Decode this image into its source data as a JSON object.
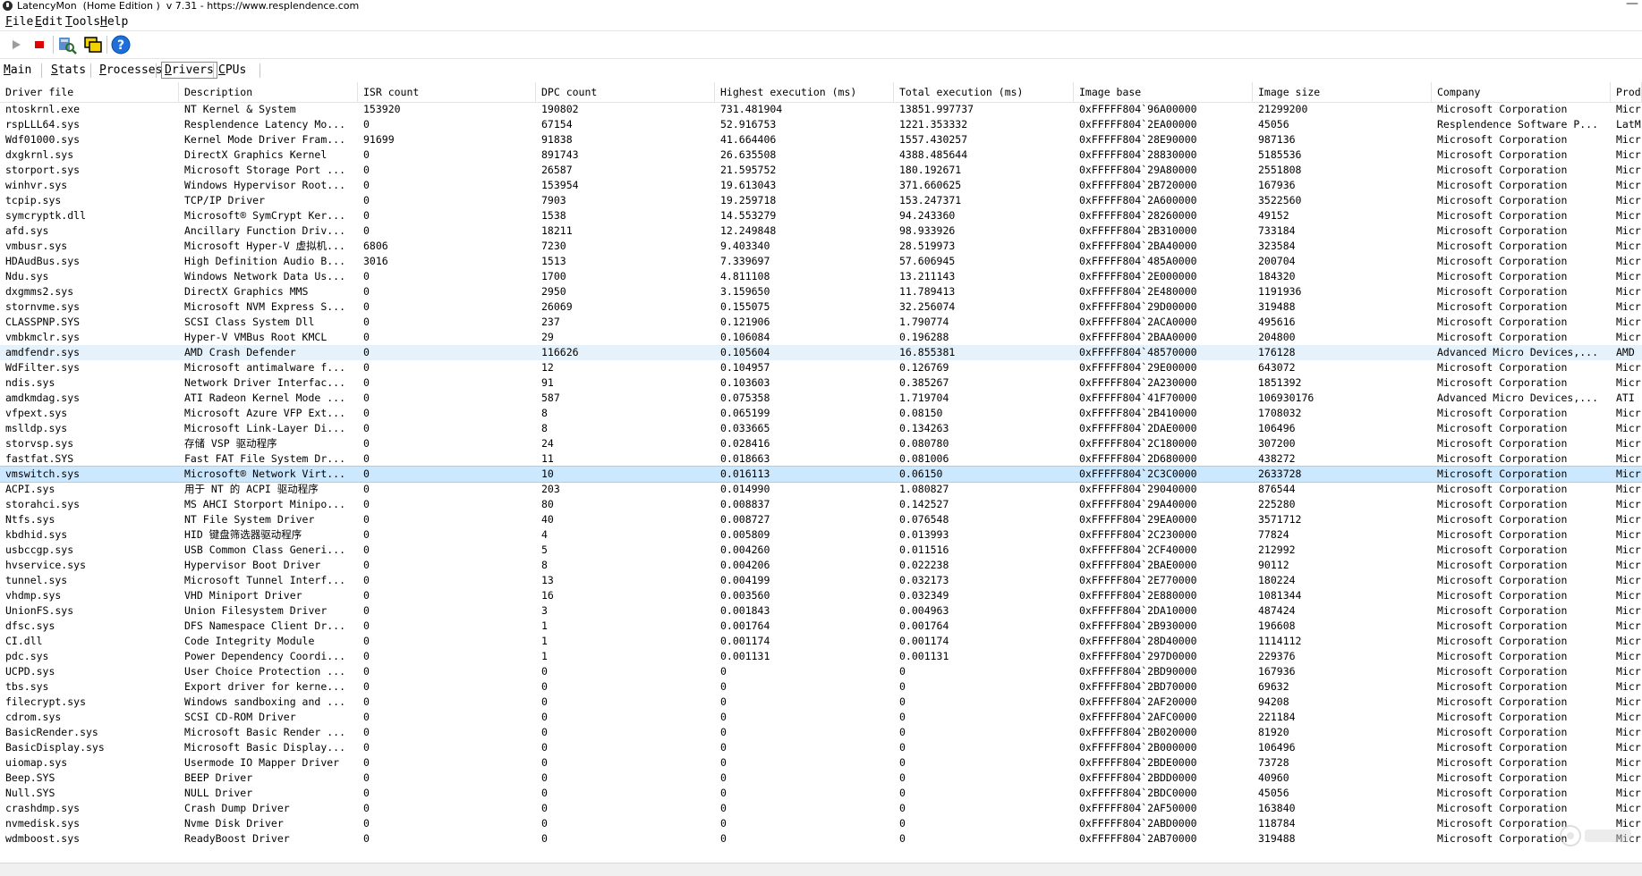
{
  "window": {
    "title": "LatencyMon  (Home Edition )  v 7.31 - https://www.resplendence.com",
    "minimize": "—"
  },
  "menu": [
    {
      "label": "File",
      "u": "F",
      "rest": "ile"
    },
    {
      "label": "Edit",
      "u": "E",
      "rest": "dit"
    },
    {
      "label": "Tools",
      "u": "T",
      "rest": "ools"
    },
    {
      "label": "Help",
      "u": "H",
      "rest": "elp"
    }
  ],
  "toolbar": {
    "icons": [
      "play-icon",
      "stop-icon",
      "search-drivers-icon",
      "windows-icon",
      "help-icon"
    ]
  },
  "tabs": [
    {
      "label": "Main",
      "u": "M",
      "rest": "ain",
      "active": false
    },
    {
      "label": "Stats",
      "u": "S",
      "rest": "tats",
      "active": false
    },
    {
      "label": "Processes",
      "u": "P",
      "rest": "rocesses",
      "active": false
    },
    {
      "label": "Drivers",
      "u": "D",
      "rest": "rivers",
      "active": true
    },
    {
      "label": "CPUs",
      "u": "C",
      "rest": "PUs",
      "active": false
    }
  ],
  "table": {
    "columns": [
      "Driver file",
      "Description",
      "ISR count",
      "DPC count",
      "Highest execution (ms)",
      "Total execution (ms)",
      "Image base",
      "Image size",
      "Company",
      "Prod"
    ],
    "rows": [
      [
        "ntoskrnl.exe",
        "NT Kernel & System",
        "153920",
        "190802",
        "731.481904",
        "13851.997737",
        "0xFFFFF804`96A00000",
        "21299200",
        "Microsoft Corporation",
        "Micr"
      ],
      [
        "rspLLL64.sys",
        "Resplendence Latency Mo...",
        "0",
        "67154",
        "52.916753",
        "1221.353332",
        "0xFFFFF804`2EA00000",
        "45056",
        "Resplendence Software P...",
        "LatM"
      ],
      [
        "Wdf01000.sys",
        "Kernel Mode Driver Fram...",
        "91699",
        "91838",
        "41.664406",
        "1557.430257",
        "0xFFFFF804`28E90000",
        "987136",
        "Microsoft Corporation",
        "Micr"
      ],
      [
        "dxgkrnl.sys",
        "DirectX Graphics Kernel",
        "0",
        "891743",
        "26.635508",
        "4388.485644",
        "0xFFFFF804`28830000",
        "5185536",
        "Microsoft Corporation",
        "Micr"
      ],
      [
        "storport.sys",
        "Microsoft Storage Port ...",
        "0",
        "26587",
        "21.595752",
        "180.192671",
        "0xFFFFF804`29A80000",
        "2551808",
        "Microsoft Corporation",
        "Micr"
      ],
      [
        "winhvr.sys",
        "Windows Hypervisor Root...",
        "0",
        "153954",
        "19.613043",
        "371.660625",
        "0xFFFFF804`2B720000",
        "167936",
        "Microsoft Corporation",
        "Micr"
      ],
      [
        "tcpip.sys",
        "TCP/IP Driver",
        "0",
        "7903",
        "19.259718",
        "153.247371",
        "0xFFFFF804`2A600000",
        "3522560",
        "Microsoft Corporation",
        "Micr"
      ],
      [
        "symcryptk.dll",
        "Microsoft® SymCrypt Ker...",
        "0",
        "1538",
        "14.553279",
        "94.243360",
        "0xFFFFF804`28260000",
        "49152",
        "Microsoft Corporation",
        "Micr"
      ],
      [
        "afd.sys",
        "Ancillary Function Driv...",
        "0",
        "18211",
        "12.249848",
        "98.933926",
        "0xFFFFF804`2B310000",
        "733184",
        "Microsoft Corporation",
        "Micr"
      ],
      [
        "vmbusr.sys",
        "Microsoft Hyper-V 虚拟机...",
        "6806",
        "7230",
        "9.403340",
        "28.519973",
        "0xFFFFF804`2BA40000",
        "323584",
        "Microsoft Corporation",
        "Micr"
      ],
      [
        "HDAudBus.sys",
        "High Definition Audio B...",
        "3016",
        "1513",
        "7.339697",
        "57.606945",
        "0xFFFFF804`485A0000",
        "200704",
        "Microsoft Corporation",
        "Micr"
      ],
      [
        "Ndu.sys",
        "Windows Network Data Us...",
        "0",
        "1700",
        "4.811108",
        "13.211143",
        "0xFFFFF804`2E000000",
        "184320",
        "Microsoft Corporation",
        "Micr"
      ],
      [
        "dxgmms2.sys",
        "DirectX Graphics MMS",
        "0",
        "2950",
        "3.159650",
        "11.789413",
        "0xFFFFF804`2E480000",
        "1191936",
        "Microsoft Corporation",
        "Micr"
      ],
      [
        "stornvme.sys",
        "Microsoft NVM Express S...",
        "0",
        "26069",
        "0.155075",
        "32.256074",
        "0xFFFFF804`29D00000",
        "319488",
        "Microsoft Corporation",
        "Micr"
      ],
      [
        "CLASSPNP.SYS",
        "SCSI Class System Dll",
        "0",
        "237",
        "0.121906",
        "1.790774",
        "0xFFFFF804`2ACA0000",
        "495616",
        "Microsoft Corporation",
        "Micr"
      ],
      [
        "vmbkmclr.sys",
        "Hyper-V VMBus Root KMCL",
        "0",
        "29",
        "0.106084",
        "0.196288",
        "0xFFFFF804`2BAA0000",
        "204800",
        "Microsoft Corporation",
        "Micr"
      ],
      [
        "amdfendr.sys",
        "AMD Crash Defender",
        "0",
        "116626",
        "0.105604",
        "16.855381",
        "0xFFFFF804`48570000",
        "176128",
        "Advanced Micro Devices,...",
        "AMD"
      ],
      [
        "WdFilter.sys",
        "Microsoft antimalware f...",
        "0",
        "12",
        "0.104957",
        "0.126769",
        "0xFFFFF804`29E00000",
        "643072",
        "Microsoft Corporation",
        "Micr"
      ],
      [
        "ndis.sys",
        "Network Driver Interfac...",
        "0",
        "91",
        "0.103603",
        "0.385267",
        "0xFFFFF804`2A230000",
        "1851392",
        "Microsoft Corporation",
        "Micr"
      ],
      [
        "amdkmdag.sys",
        "ATI Radeon Kernel Mode ...",
        "0",
        "587",
        "0.075358",
        "1.719704",
        "0xFFFFF804`41F70000",
        "106930176",
        "Advanced Micro Devices,...",
        "ATI"
      ],
      [
        "vfpext.sys",
        "Microsoft Azure VFP Ext...",
        "0",
        "8",
        "0.065199",
        "0.08150",
        "0xFFFFF804`2B410000",
        "1708032",
        "Microsoft Corporation",
        "Micr"
      ],
      [
        "mslldp.sys",
        "Microsoft Link-Layer Di...",
        "0",
        "8",
        "0.033665",
        "0.134263",
        "0xFFFFF804`2DAE0000",
        "106496",
        "Microsoft Corporation",
        "Micr"
      ],
      [
        "storvsp.sys",
        "存储 VSP 驱动程序",
        "0",
        "24",
        "0.028416",
        "0.080780",
        "0xFFFFF804`2C180000",
        "307200",
        "Microsoft Corporation",
        "Micr"
      ],
      [
        "fastfat.SYS",
        "Fast FAT File System Dr...",
        "0",
        "11",
        "0.018663",
        "0.081006",
        "0xFFFFF804`2D680000",
        "438272",
        "Microsoft Corporation",
        "Micr"
      ],
      [
        "vmswitch.sys",
        "Microsoft® Network Virt...",
        "0",
        "10",
        "0.016113",
        "0.06150",
        "0xFFFFF804`2C3C0000",
        "2633728",
        "Microsoft Corporation",
        "Micr"
      ],
      [
        "ACPI.sys",
        "用于 NT 的 ACPI 驱动程序",
        "0",
        "203",
        "0.014990",
        "1.080827",
        "0xFFFFF804`29040000",
        "876544",
        "Microsoft Corporation",
        "Micr"
      ],
      [
        "storahci.sys",
        "MS AHCI Storport Minipo...",
        "0",
        "80",
        "0.008837",
        "0.142527",
        "0xFFFFF804`29A40000",
        "225280",
        "Microsoft Corporation",
        "Micr"
      ],
      [
        "Ntfs.sys",
        "NT File System Driver",
        "0",
        "40",
        "0.008727",
        "0.076548",
        "0xFFFFF804`29EA0000",
        "3571712",
        "Microsoft Corporation",
        "Micr"
      ],
      [
        "kbdhid.sys",
        "HID 键盘筛选器驱动程序",
        "0",
        "4",
        "0.005809",
        "0.013993",
        "0xFFFFF804`2C230000",
        "77824",
        "Microsoft Corporation",
        "Micr"
      ],
      [
        "usbccgp.sys",
        "USB Common Class Generi...",
        "0",
        "5",
        "0.004260",
        "0.011516",
        "0xFFFFF804`2CF40000",
        "212992",
        "Microsoft Corporation",
        "Micr"
      ],
      [
        "hvservice.sys",
        "Hypervisor Boot Driver",
        "0",
        "8",
        "0.004206",
        "0.022238",
        "0xFFFFF804`2BAE0000",
        "90112",
        "Microsoft Corporation",
        "Micr"
      ],
      [
        "tunnel.sys",
        "Microsoft Tunnel Interf...",
        "0",
        "13",
        "0.004199",
        "0.032173",
        "0xFFFFF804`2E770000",
        "180224",
        "Microsoft Corporation",
        "Micr"
      ],
      [
        "vhdmp.sys",
        "VHD Miniport Driver",
        "0",
        "16",
        "0.003560",
        "0.032349",
        "0xFFFFF804`2E880000",
        "1081344",
        "Microsoft Corporation",
        "Micr"
      ],
      [
        "UnionFS.sys",
        "Union Filesystem Driver",
        "0",
        "3",
        "0.001843",
        "0.004963",
        "0xFFFFF804`2DA10000",
        "487424",
        "Microsoft Corporation",
        "Micr"
      ],
      [
        "dfsc.sys",
        "DFS Namespace Client Dr...",
        "0",
        "1",
        "0.001764",
        "0.001764",
        "0xFFFFF804`2B930000",
        "196608",
        "Microsoft Corporation",
        "Micr"
      ],
      [
        "CI.dll",
        "Code Integrity Module",
        "0",
        "1",
        "0.001174",
        "0.001174",
        "0xFFFFF804`28D40000",
        "1114112",
        "Microsoft Corporation",
        "Micr"
      ],
      [
        "pdc.sys",
        "Power Dependency Coordi...",
        "0",
        "1",
        "0.001131",
        "0.001131",
        "0xFFFFF804`297D0000",
        "229376",
        "Microsoft Corporation",
        "Micr"
      ],
      [
        "UCPD.sys",
        "User Choice Protection ...",
        "0",
        "0",
        "0",
        "0",
        "0xFFFFF804`2BD90000",
        "167936",
        "Microsoft Corporation",
        "Micr"
      ],
      [
        "tbs.sys",
        "Export driver for kerne...",
        "0",
        "0",
        "0",
        "0",
        "0xFFFFF804`2BD70000",
        "69632",
        "Microsoft Corporation",
        "Micr"
      ],
      [
        "filecrypt.sys",
        "Windows sandboxing and ...",
        "0",
        "0",
        "0",
        "0",
        "0xFFFFF804`2AF20000",
        "94208",
        "Microsoft Corporation",
        "Micr"
      ],
      [
        "cdrom.sys",
        "SCSI CD-ROM Driver",
        "0",
        "0",
        "0",
        "0",
        "0xFFFFF804`2AFC0000",
        "221184",
        "Microsoft Corporation",
        "Micr"
      ],
      [
        "BasicRender.sys",
        "Microsoft Basic Render ...",
        "0",
        "0",
        "0",
        "0",
        "0xFFFFF804`2B020000",
        "81920",
        "Microsoft Corporation",
        "Micr"
      ],
      [
        "BasicDisplay.sys",
        "Microsoft Basic Display...",
        "0",
        "0",
        "0",
        "0",
        "0xFFFFF804`2B000000",
        "106496",
        "Microsoft Corporation",
        "Micr"
      ],
      [
        "uiomap.sys",
        "Usermode IO Mapper Driver",
        "0",
        "0",
        "0",
        "0",
        "0xFFFFF804`2BDE0000",
        "73728",
        "Microsoft Corporation",
        "Micr"
      ],
      [
        "Beep.SYS",
        "BEEP Driver",
        "0",
        "0",
        "0",
        "0",
        "0xFFFFF804`2BDD0000",
        "40960",
        "Microsoft Corporation",
        "Micr"
      ],
      [
        "Null.SYS",
        "NULL Driver",
        "0",
        "0",
        "0",
        "0",
        "0xFFFFF804`2BDC0000",
        "45056",
        "Microsoft Corporation",
        "Micr"
      ],
      [
        "crashdmp.sys",
        "Crash Dump Driver",
        "0",
        "0",
        "0",
        "0",
        "0xFFFFF804`2AF50000",
        "163840",
        "Microsoft Corporation",
        "Micr"
      ],
      [
        "nvmedisk.sys",
        "Nvme Disk Driver",
        "0",
        "0",
        "0",
        "0",
        "0xFFFFF804`2ABD0000",
        "118784",
        "Microsoft Corporation",
        "Micr"
      ],
      [
        "wdmboost.sys",
        "ReadyBoost Driver",
        "0",
        "0",
        "0",
        "0",
        "0xFFFFF804`2AB70000",
        "319488",
        "Microsoft Corporation",
        "Micr"
      ]
    ],
    "highlight_row": 16,
    "selected_row": 24
  }
}
